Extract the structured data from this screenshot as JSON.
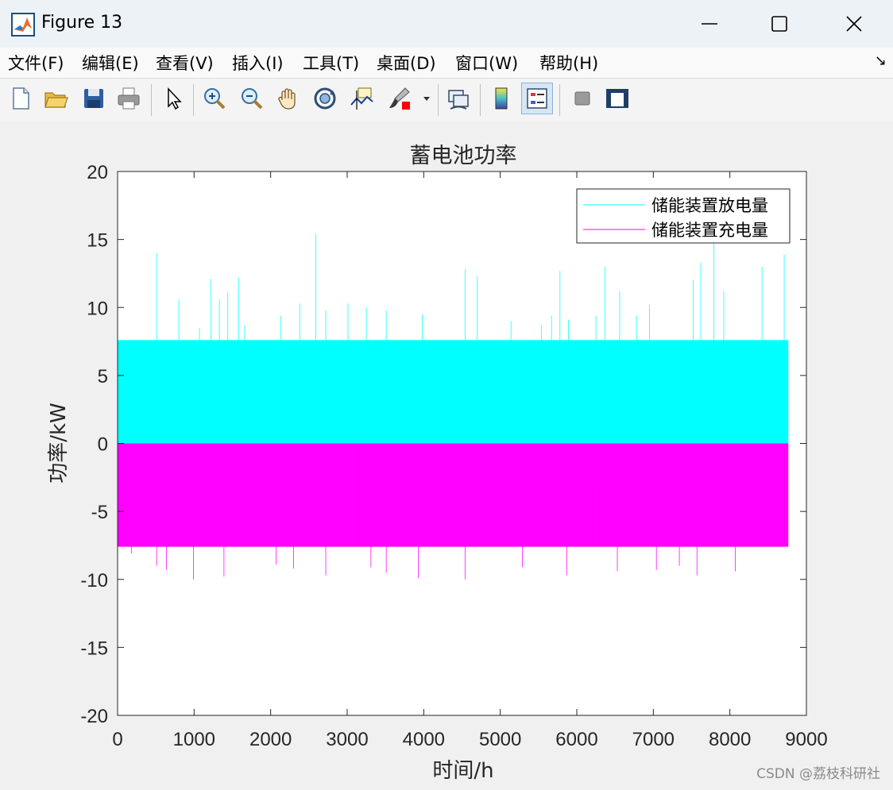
{
  "window": {
    "title": "Figure 13",
    "minimize_icon": "minimize-icon",
    "maximize_icon": "maximize-icon",
    "close_icon": "close-icon"
  },
  "menu": [
    "文件(F)",
    "编辑(E)",
    "查看(V)",
    "插入(I)",
    "工具(T)",
    "桌面(D)",
    "窗口(W)",
    "帮助(H)"
  ],
  "toolbar": {
    "items": [
      "new-figure-icon",
      "open-folder-icon",
      "save-icon",
      "print-icon",
      "pointer-arrow-icon",
      "zoom-in-icon",
      "zoom-out-icon",
      "pan-hand-icon",
      "rotate-3d-icon",
      "data-cursor-icon",
      "brush-icon",
      "link-plot-icon",
      "colorbar-icon",
      "legend-icon",
      "hide-plot-tools-icon",
      "show-plot-tools-icon"
    ],
    "active": "legend-icon"
  },
  "colors": {
    "discharge": "#00ffff",
    "charge": "#ff00ff",
    "axes": "#262626",
    "background": "#f0f0f0"
  },
  "chart_data": {
    "type": "bar",
    "title": "蓄电池功率",
    "xlabel": "时间/h",
    "ylabel": "功率/kW",
    "xlim": [
      0,
      9000
    ],
    "ylim": [
      -20,
      20
    ],
    "xticks": [
      0,
      1000,
      2000,
      3000,
      4000,
      5000,
      6000,
      7000,
      8000,
      9000
    ],
    "yticks": [
      -20,
      -15,
      -10,
      -5,
      0,
      5,
      10,
      15,
      20
    ],
    "grid": false,
    "legend_position": "top-right",
    "x_range": [
      1,
      8760
    ],
    "series": [
      {
        "name": "储能装置放电量",
        "color": "#00ffff",
        "typical_peak": 7.6,
        "spikes": [
          [
            510,
            14.0
          ],
          [
            800,
            10.6
          ],
          [
            1070,
            8.5
          ],
          [
            1220,
            12.1
          ],
          [
            1330,
            10.6
          ],
          [
            1440,
            11.1
          ],
          [
            1580,
            12.2
          ],
          [
            1660,
            8.7
          ],
          [
            2130,
            9.4
          ],
          [
            2380,
            10.3
          ],
          [
            2590,
            15.4
          ],
          [
            2720,
            9.8
          ],
          [
            3010,
            10.3
          ],
          [
            3250,
            10.0
          ],
          [
            3510,
            9.8
          ],
          [
            3980,
            9.5
          ],
          [
            4540,
            12.8
          ],
          [
            4700,
            12.3
          ],
          [
            5140,
            9.0
          ],
          [
            5540,
            8.7
          ],
          [
            5670,
            9.4
          ],
          [
            5780,
            12.7
          ],
          [
            5890,
            9.1
          ],
          [
            6250,
            9.4
          ],
          [
            6370,
            13.0
          ],
          [
            6560,
            11.2
          ],
          [
            6780,
            9.4
          ],
          [
            6950,
            10.2
          ],
          [
            7520,
            12.0
          ],
          [
            7620,
            13.3
          ],
          [
            7790,
            14.7
          ],
          [
            7920,
            11.2
          ],
          [
            8420,
            13.0
          ],
          [
            8710,
            13.9
          ]
        ]
      },
      {
        "name": "储能装置充电量",
        "color": "#ff00ff",
        "typical_trough": -7.6,
        "spikes": [
          [
            180,
            -8.1
          ],
          [
            510,
            -9.0
          ],
          [
            640,
            -9.3
          ],
          [
            990,
            -10.0
          ],
          [
            1390,
            -9.8
          ],
          [
            2070,
            -8.9
          ],
          [
            2300,
            -9.2
          ],
          [
            2720,
            -9.7
          ],
          [
            3310,
            -9.1
          ],
          [
            3510,
            -9.5
          ],
          [
            3930,
            -9.9
          ],
          [
            4540,
            -10.0
          ],
          [
            5290,
            -9.1
          ],
          [
            5870,
            -9.7
          ],
          [
            6530,
            -9.4
          ],
          [
            7040,
            -9.3
          ],
          [
            7340,
            -9.0
          ],
          [
            7570,
            -9.7
          ],
          [
            8070,
            -9.4
          ]
        ]
      }
    ]
  },
  "watermark": "CSDN @荔枝科研社"
}
